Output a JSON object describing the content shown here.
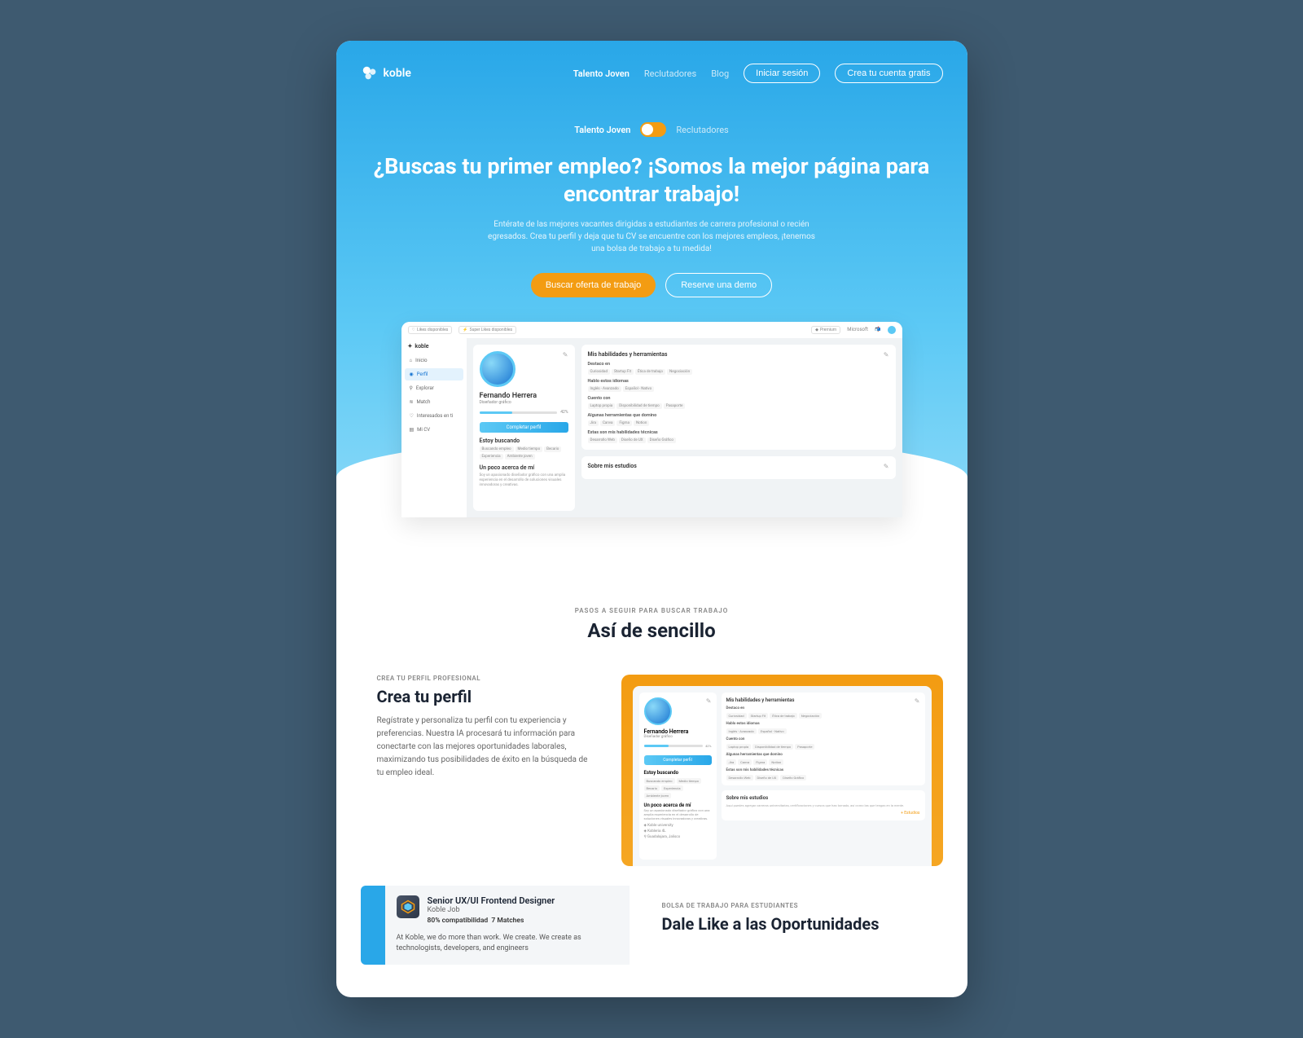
{
  "brand": "koble",
  "nav": {
    "links": [
      "Talento Joven",
      "Reclutadores",
      "Blog"
    ],
    "login": "Iniciar sesión",
    "signup": "Crea tu cuenta gratis"
  },
  "toggle": {
    "left": "Talento Joven",
    "right": "Reclutadores"
  },
  "hero": {
    "title": "¿Buscas tu primer empleo? ¡Somos la mejor página para encontrar trabajo!",
    "subtitle": "Entérate de las mejores vacantes dirigidas a estudiantes de carrera profesional o recién egresados. Crea tu perfil y deja que tu CV se encuentre con los mejores empleos, ¡tenemos una bolsa de trabajo a tu medida!",
    "cta1": "Buscar oferta de trabajo",
    "cta2": "Reserve una demo"
  },
  "dash": {
    "likes": "Likes disponibles",
    "superlikes": "Super Likes disponibles",
    "premium": "Premium",
    "user": "Microsoft",
    "side": [
      "Inicio",
      "Perfil",
      "Explorar",
      "Match",
      "Interesados en ti",
      "Mi CV"
    ],
    "name": "Fernando Herrera",
    "role": "Diseñador gráfico",
    "percent": "42%",
    "complete": "Completar perfil",
    "looking": "Estoy buscando",
    "lookingChips": [
      "Buscando empleo",
      "Medio tiempo",
      "Becario",
      "Experiencia",
      "Ambiente joven"
    ],
    "about": "Un poco acerca de mí",
    "aboutText": "Soy un apasionado diseñador gráfico con una amplia experiencia en el desarrollo de soluciones visuales innovadoras y creativas.",
    "skills": "Mis habilidades y herramientas",
    "destaco": "Destaco en",
    "destacoChips": [
      "Curiosidad",
      "Startup Fit",
      "Ética de trabajo",
      "Negociación"
    ],
    "idiomas": "Hablo estos idiomas",
    "idiomasChips": [
      "Inglés - Avanzado",
      "Español - Nativo"
    ],
    "cuento": "Cuento con",
    "cuentoChips": [
      "Laptop propia",
      "Disponibilidad de tiempo",
      "Pasaporte"
    ],
    "herramientas": "Algunas herramientas que domino",
    "herramientasChips": [
      "Jira",
      "Canva",
      "Figma",
      "Notion"
    ],
    "tecnicas": "Estas son mis habilidades técnicas",
    "tecnicasChips": [
      "Desarrollo Web",
      "Diseño de UX",
      "Diseño Gráfico"
    ],
    "estudios": "Sobre mis estudios"
  },
  "section2": {
    "eyebrow": "PASOS A SEGUIR PARA BUSCAR TRABAJO",
    "title": "Así de sencillo"
  },
  "step1": {
    "eyebrow": "CREA TU PERFIL PROFESIONAL",
    "title": "Crea tu perfil",
    "body": "Regístrate y personaliza tu perfil con tu experiencia y preferencias. Nuestra IA procesará tu información para conectarte con las mejores oportunidades laborales, maximizando tus posibilidades de éxito en la búsqueda de tu empleo ideal.",
    "estudios2": "+ Estudios",
    "univ": "Koble university",
    "carrera": "Kobleria 4L",
    "lugar": "Guadalajara, Jalisco"
  },
  "job": {
    "title": "Senior UX/UI Frontend Designer",
    "company": "Koble Job",
    "compat": "80% compatibilidad",
    "matches": "7 Matches",
    "desc": "At Koble, we do more than work. We create. We create as technologists, developers, and engineers"
  },
  "step2": {
    "eyebrow": "BOLSA DE TRABAJO PARA ESTUDIANTES",
    "title": "Dale Like a las Oportunidades"
  }
}
